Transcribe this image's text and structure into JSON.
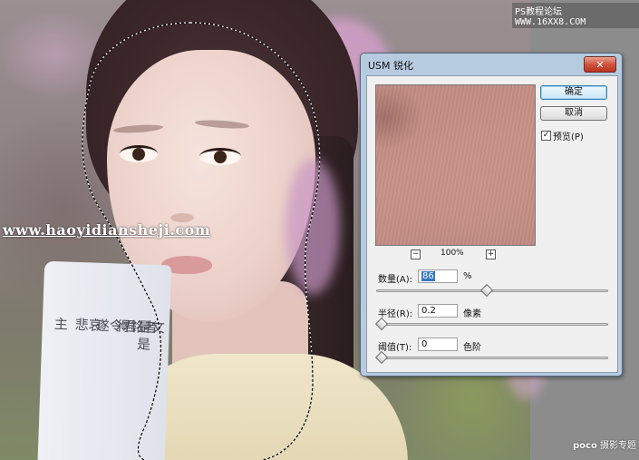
{
  "watermarks": {
    "site_top": "PS教程论坛 WWW.16XX8.COM",
    "url_left": "www.haoyidiansheji.com",
    "poco_brand": "poco",
    "poco_text": "摄影专题"
  },
  "photo": {
    "scroll_columns": [
      "是文是",
      "得銘者",
      "遂令君",
      "悲哀",
      "主"
    ]
  },
  "dialog": {
    "title": "USM 锐化",
    "close_glyph": "✕",
    "ok_label": "确定",
    "cancel_label": "取消",
    "preview_label": "预览(P)",
    "preview_checked": true,
    "zoom": {
      "minus": "−",
      "value": "100%",
      "plus": "+"
    },
    "amount": {
      "label": "数量(A):",
      "value": "86",
      "unit": "%",
      "slider_fraction": 0.47
    },
    "radius": {
      "label": "半径(R):",
      "value": "0.2",
      "unit": "像素",
      "slider_fraction": 0.0
    },
    "threshold": {
      "label": "阈值(T):",
      "value": "0",
      "unit": "色阶",
      "slider_fraction": 0.0
    }
  }
}
